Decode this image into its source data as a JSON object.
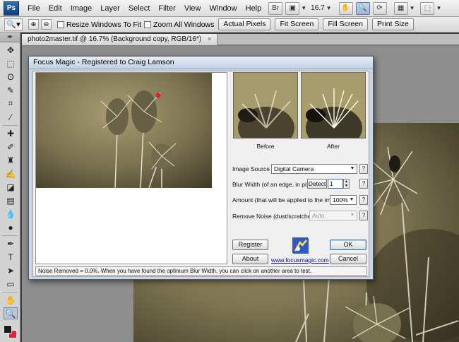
{
  "app": {
    "logo_text": "Ps",
    "menu": [
      "File",
      "Edit",
      "Image",
      "Layer",
      "Select",
      "Filter",
      "View",
      "Window",
      "Help"
    ],
    "zoom_field": "16.7"
  },
  "options_bar": {
    "resize_windows_label": "Resize Windows To Fit",
    "zoom_all_windows_label": "Zoom All Windows",
    "buttons": [
      "Actual Pixels",
      "Fit Screen",
      "Fill Screen",
      "Print Size"
    ]
  },
  "document": {
    "tab_title": "photo2master.tif @ 16.7% (Background copy, RGB/16*)",
    "close_glyph": "×"
  },
  "dialog": {
    "title": "Focus Magic - Registered to Craig Lamson",
    "before_label": "Before",
    "after_label": "After",
    "image_source": {
      "label": "Image Source",
      "value": "Digital Camera"
    },
    "blur_width": {
      "label": "Blur Width (of an edge, in pixels)",
      "detect_label": "Detect",
      "value": "1"
    },
    "amount": {
      "label": "Amount (that will be applied to the image)",
      "value": "100%"
    },
    "remove_noise": {
      "label": "Remove Noise (dust/scratches)",
      "value": "Auto"
    },
    "help_glyph": "?",
    "register_label": "Register",
    "about_label": "About",
    "ok_label": "OK",
    "cancel_label": "Cancel",
    "website": "www.focusmagic.com",
    "status_text": "Noise Removed = 0.0%. When you have found the optimum Blur Width, you can click on another area to test."
  },
  "colors": {
    "foreground": "#1a1a1a",
    "background": "#e8203c"
  }
}
